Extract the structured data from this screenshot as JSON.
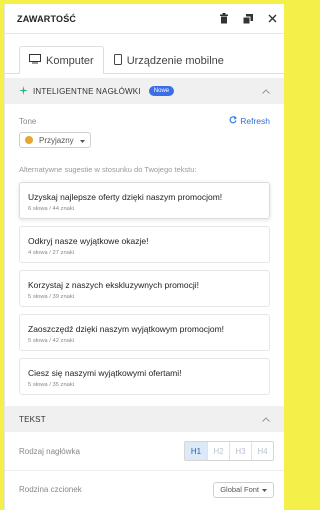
{
  "header": {
    "title": "ZAWARTOŚĆ"
  },
  "tabs": [
    {
      "label": "Komputer",
      "active": true
    },
    {
      "label": "Urządzenie mobilne",
      "active": false
    }
  ],
  "smart_headlines": {
    "title": "INTELIGENTNE NAGŁÓWKI",
    "badge": "Nowe",
    "tone_label": "Tone",
    "refresh_label": "Refresh",
    "tone_value": "Przyjazny",
    "alternatives_label": "Alternatywne sugestie w stosunku do Twojego tekstu:",
    "suggestions": [
      {
        "text": "Uzyskaj najlepsze oferty dzięki naszym promocjom!",
        "meta": "6 słowa / 44 znaki"
      },
      {
        "text": "Odkryj nasze wyjątkowe okazje!",
        "meta": "4 słowa / 27 znaki"
      },
      {
        "text": "Korzystaj z naszych ekskluzywnych promocji!",
        "meta": "5 słowa / 39 znaki"
      },
      {
        "text": "Zaoszczędź dzięki naszym wyjątkowym promocjom!",
        "meta": "5 słowa / 42 znaki"
      },
      {
        "text": "Ciesz się naszymi wyjątkowymi ofertami!",
        "meta": "5 słowa / 35 znaki"
      }
    ]
  },
  "text_section": {
    "title": "TEKST",
    "heading_type_label": "Rodzaj nagłówka",
    "heading_options": [
      "H1",
      "H2",
      "H3",
      "H4"
    ],
    "heading_selected": "H1",
    "font_family_label": "Rodzina czcionek",
    "font_family_value": "Global Font"
  },
  "colors": {
    "accent": "#3a6fe8",
    "link": "#2a72d6",
    "background": "#f5ef4a"
  }
}
